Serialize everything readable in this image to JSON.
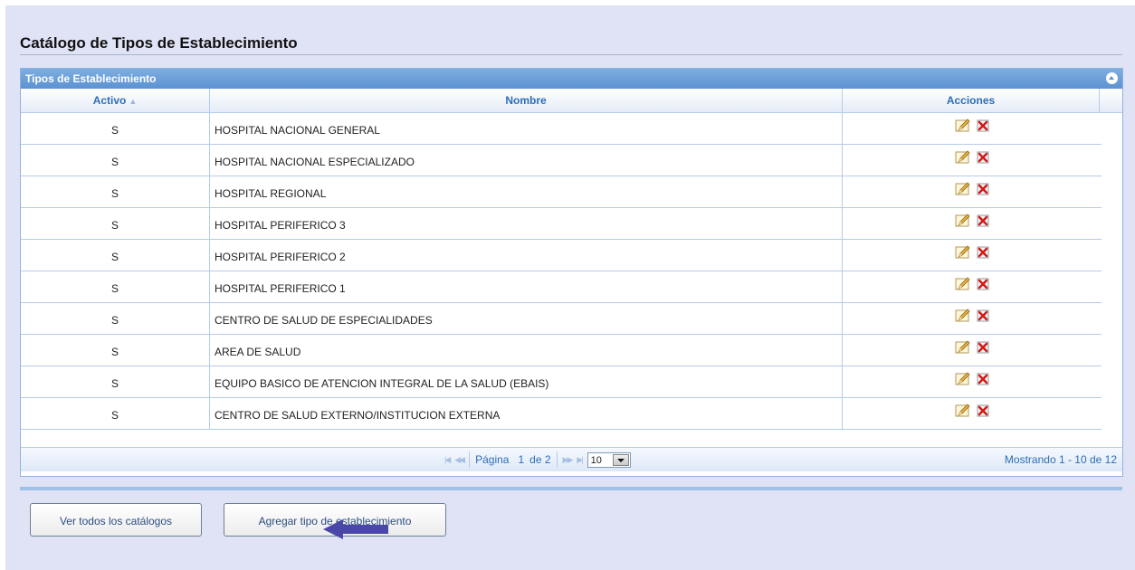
{
  "page": {
    "title": "Catálogo de Tipos de Establecimiento"
  },
  "grid": {
    "caption": "Tipos de Establecimiento",
    "columns": {
      "activo": "Activo",
      "nombre": "Nombre",
      "acciones": "Acciones"
    },
    "rows": [
      {
        "activo": "S",
        "nombre": "HOSPITAL NACIONAL GENERAL"
      },
      {
        "activo": "S",
        "nombre": "HOSPITAL NACIONAL ESPECIALIZADO"
      },
      {
        "activo": "S",
        "nombre": "HOSPITAL REGIONAL"
      },
      {
        "activo": "S",
        "nombre": "HOSPITAL PERIFERICO 3"
      },
      {
        "activo": "S",
        "nombre": "HOSPITAL PERIFERICO 2"
      },
      {
        "activo": "S",
        "nombre": "HOSPITAL PERIFERICO 1"
      },
      {
        "activo": "S",
        "nombre": "CENTRO DE SALUD DE ESPECIALIDADES"
      },
      {
        "activo": "S",
        "nombre": "AREA DE SALUD"
      },
      {
        "activo": "S",
        "nombre": "EQUIPO BASICO DE ATENCION INTEGRAL DE LA SALUD (EBAIS)"
      },
      {
        "activo": "S",
        "nombre": "CENTRO DE SALUD EXTERNO/INSTITUCION EXTERNA"
      }
    ],
    "row_actions": [
      "edit-icon",
      "delete-icon"
    ],
    "pager": {
      "page_label": "Página",
      "current_page": "1",
      "of_label": "de 2",
      "page_size": "10",
      "records": "Mostrando 1 - 10 de 12"
    }
  },
  "buttons": {
    "view_all": "Ver todos los catálogos",
    "add_type": "Agregar tipo de establecimiento"
  },
  "colors": {
    "caption": "#5b92d3",
    "header_text": "#2e6eb5",
    "background": "#e0e3f5",
    "pointer": "#4a47a8"
  }
}
